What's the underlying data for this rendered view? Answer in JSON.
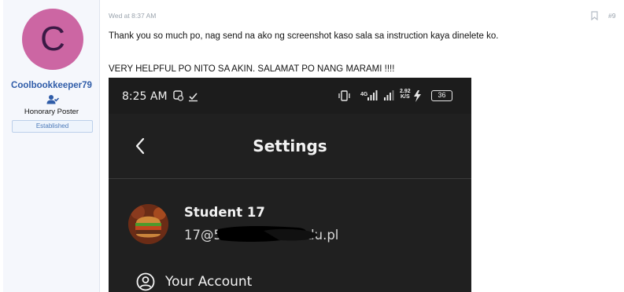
{
  "user": {
    "avatar_letter": "C",
    "avatar_color": "#cc66a3",
    "username": "Coolbookkeeper79",
    "role": "Honorary Poster",
    "badge": "Established",
    "user_icon": "user-check-icon"
  },
  "post": {
    "date": "Wed at 8:37 AM",
    "number": "#9",
    "bookmark_icon": "bookmark-icon",
    "message_1": "Thank you so much po, nag send na ako ng screenshot kaso sala sa instruction kaya dinelete ko.",
    "message_2": "VERY HELPFUL PO NITO SA AKIN. SALAMAT PO NANG MARAMI !!!!"
  },
  "screenshot": {
    "status_time": "8:25 AM",
    "network_speed_value": "2.92",
    "network_speed_unit": "K/S",
    "battery": "36",
    "signal_label": "4G",
    "title": "Settings",
    "back_icon": "chevron-left-icon",
    "profile_name": "Student 17",
    "profile_email_start": "17@5",
    "profile_email_end": "edu.pl",
    "account_label": "Your Account",
    "account_icon": "user-circle-icon",
    "background": "#202020"
  },
  "colors": {
    "username": "#2f5ca8",
    "badge_text": "#4a78b8",
    "sidebar_bg": "#f5f7fc"
  }
}
